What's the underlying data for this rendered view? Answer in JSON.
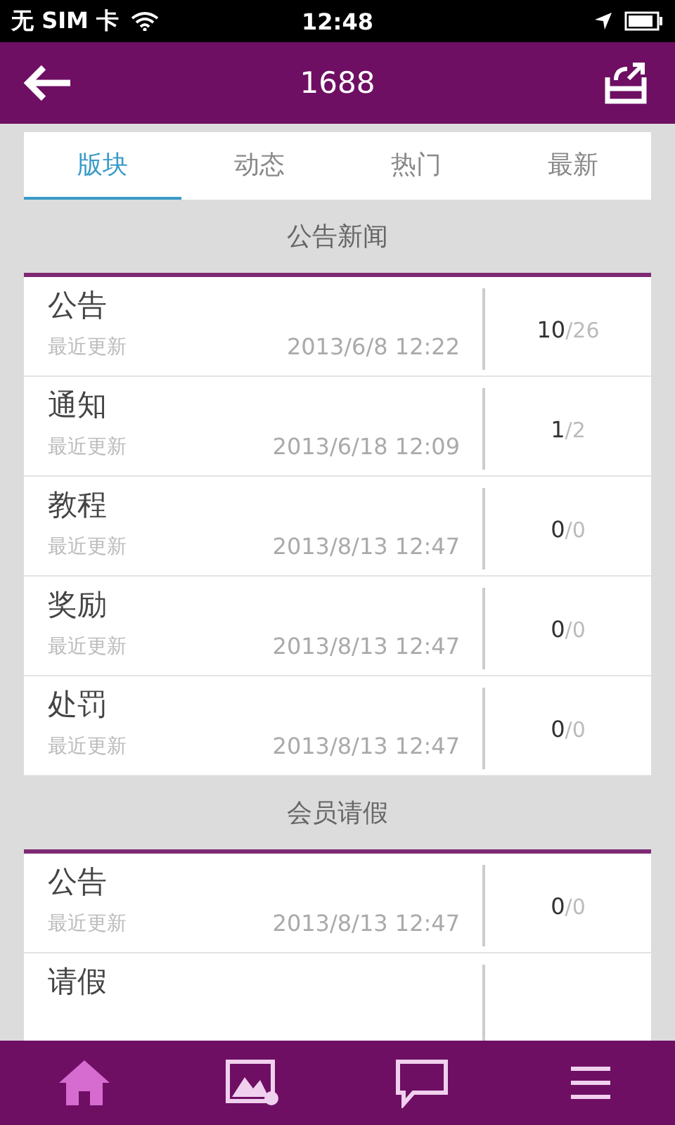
{
  "status_bar": {
    "carrier": "无 SIM 卡",
    "time": "12:48"
  },
  "header": {
    "title": "1688"
  },
  "tabs": [
    {
      "label": "版块",
      "selected": true
    },
    {
      "label": "动态",
      "selected": false
    },
    {
      "label": "热门",
      "selected": false
    },
    {
      "label": "最新",
      "selected": false
    }
  ],
  "sections": [
    {
      "title": "公告新闻",
      "rows": [
        {
          "title": "公告",
          "subtitle": "最近更新",
          "date": "2013/6/8 12:22",
          "count": "**10**/26"
        },
        {
          "title": "通知",
          "subtitle": "最近更新",
          "date": "2013/6/18 12:09",
          "count": "**1**/2"
        },
        {
          "title": "教程",
          "subtitle": "最近更新",
          "date": "2013/8/13 12:47",
          "count": "**0**/0"
        },
        {
          "title": "奖励",
          "subtitle": "最近更新",
          "date": "2013/8/13 12:47",
          "count": "**0**/0"
        },
        {
          "title": "处罚",
          "subtitle": "最近更新",
          "date": "2013/8/13 12:47",
          "count": "**0**/0"
        }
      ]
    },
    {
      "title": "会员请假",
      "rows": [
        {
          "title": "公告",
          "subtitle": "最近更新",
          "date": "2013/8/13 12:47",
          "count": "**0**/0"
        },
        {
          "title": "请假"
        }
      ]
    }
  ]
}
